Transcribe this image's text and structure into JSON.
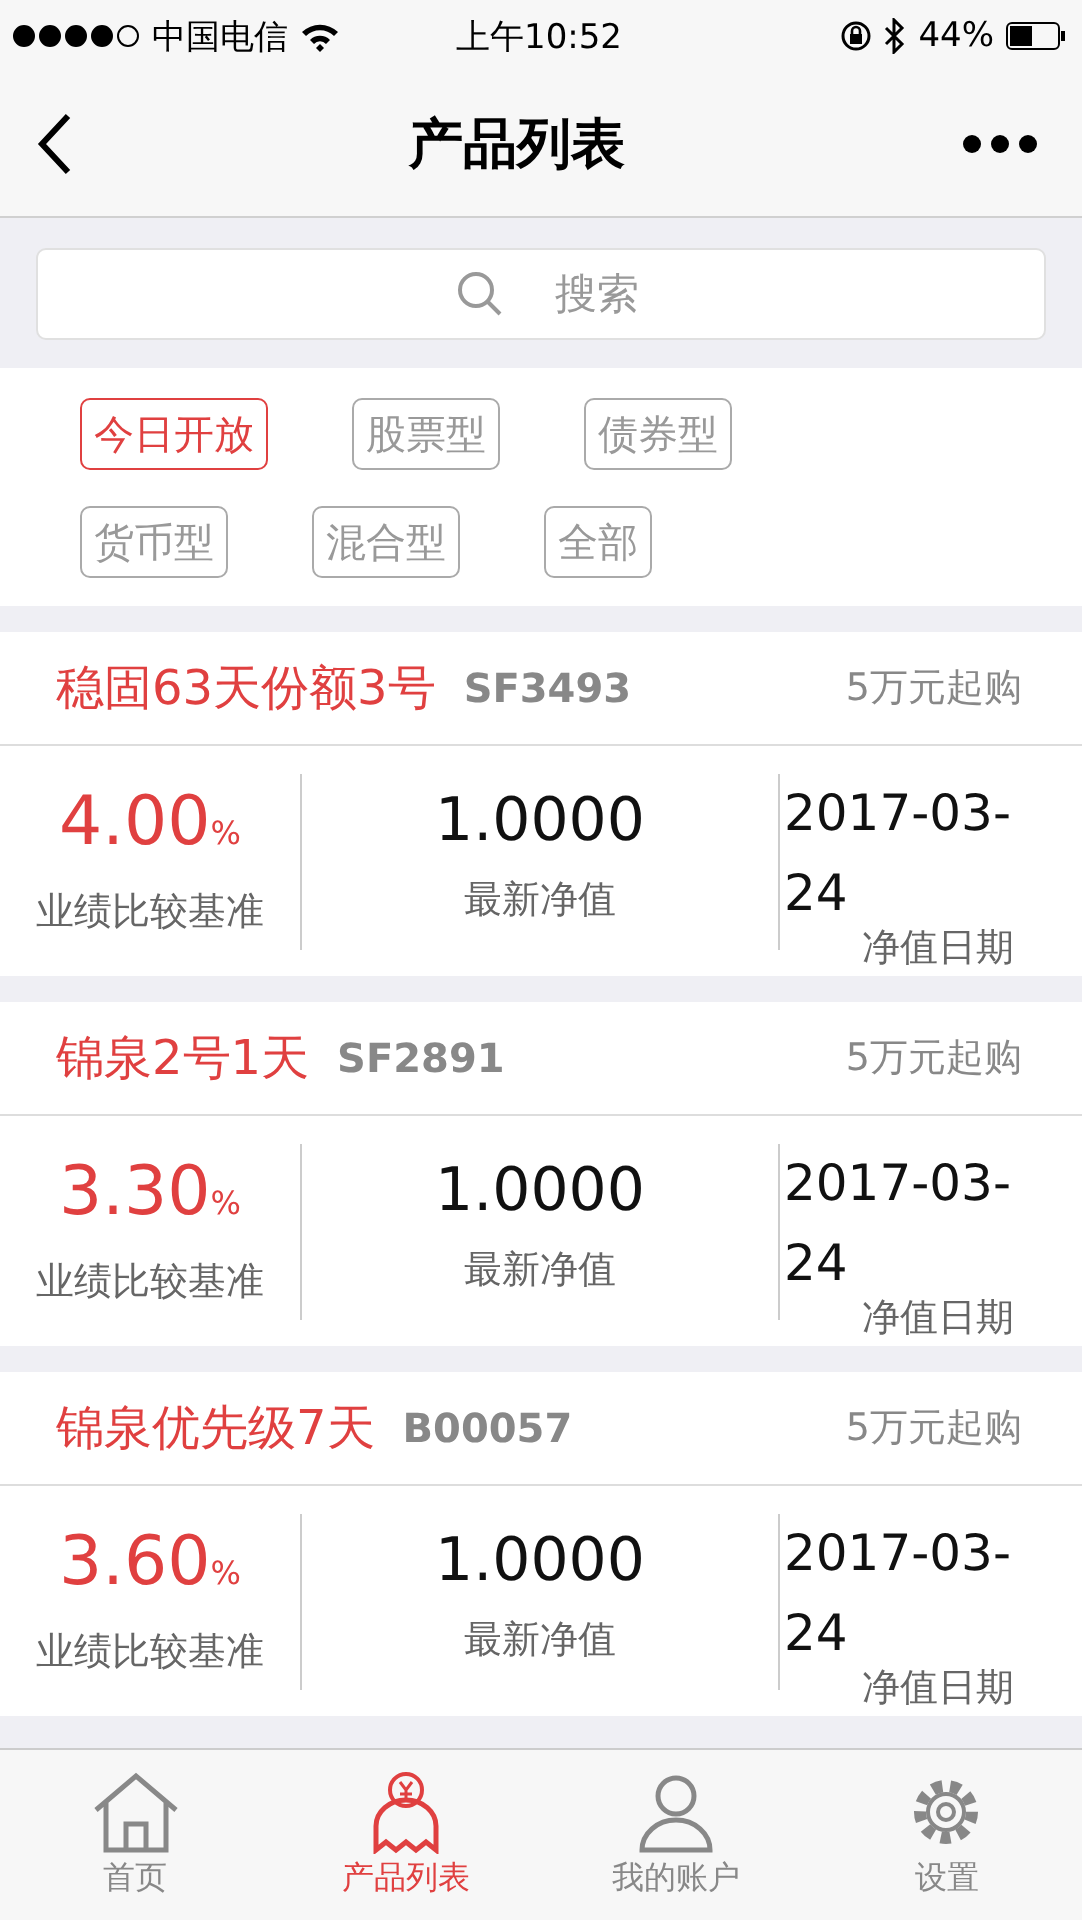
{
  "status_bar": {
    "carrier": "中国电信",
    "time": "上午10:52",
    "battery": "44%"
  },
  "nav": {
    "title": "产品列表"
  },
  "search": {
    "placeholder": "搜索"
  },
  "filters": [
    {
      "label": "今日开放",
      "selected": true
    },
    {
      "label": "股票型",
      "selected": false
    },
    {
      "label": "债券型",
      "selected": false
    },
    {
      "label": "货币型",
      "selected": false
    },
    {
      "label": "混合型",
      "selected": false
    },
    {
      "label": "全部",
      "selected": false
    }
  ],
  "products": [
    {
      "name": "稳固63天份额3号",
      "code": "SF3493",
      "min_purchase": "5万元起购",
      "rate": "4.00",
      "rate_unit": "%",
      "rate_label": "业绩比较基准",
      "nav_value": "1.0000",
      "nav_label": "最新净值",
      "date": "2017-03-24",
      "date_label": "净值日期"
    },
    {
      "name": "锦泉2号1天",
      "code": "SF2891",
      "min_purchase": "5万元起购",
      "rate": "3.30",
      "rate_unit": "%",
      "rate_label": "业绩比较基准",
      "nav_value": "1.0000",
      "nav_label": "最新净值",
      "date": "2017-03-24",
      "date_label": "净值日期"
    },
    {
      "name": "锦泉优先级7天",
      "code": "B00057",
      "min_purchase": "5万元起购",
      "rate": "3.60",
      "rate_unit": "%",
      "rate_label": "业绩比较基准",
      "nav_value": "1.0000",
      "nav_label": "最新净值",
      "date": "2017-03-24",
      "date_label": "净值日期"
    }
  ],
  "tabs": [
    {
      "label": "首页",
      "selected": false,
      "kind": "home"
    },
    {
      "label": "产品列表",
      "selected": true,
      "kind": "products"
    },
    {
      "label": "我的账户",
      "selected": false,
      "kind": "account"
    },
    {
      "label": "设置",
      "selected": false,
      "kind": "settings"
    }
  ]
}
